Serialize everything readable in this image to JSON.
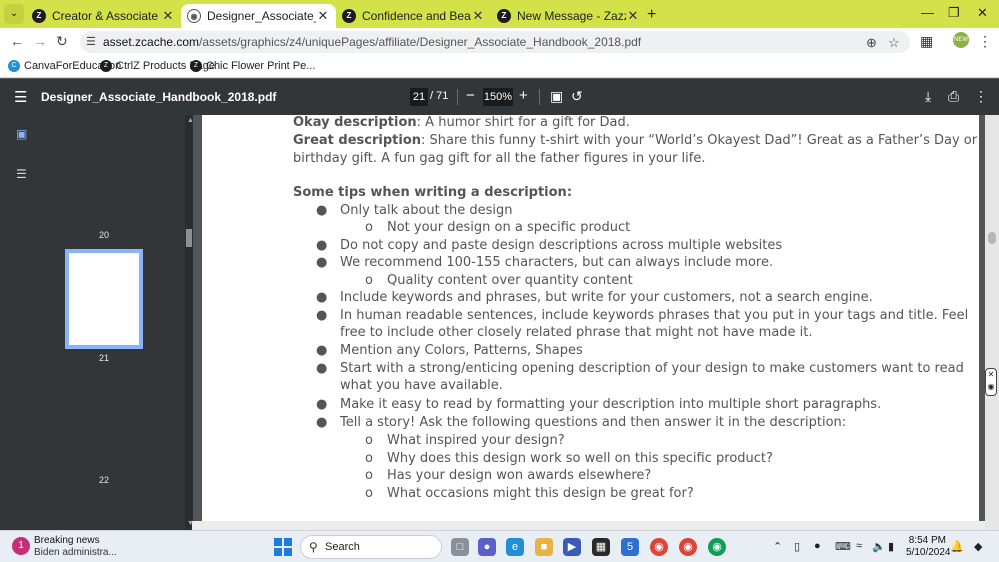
{
  "browser": {
    "tabs": [
      {
        "title": "Creator & Associate Handbook",
        "favicon": "z"
      },
      {
        "title": "Designer_Associate_Handbook",
        "favicon": "globe"
      },
      {
        "title": "Confidence and Beauty Positive",
        "favicon": "z"
      },
      {
        "title": "New Message - Zazzle",
        "favicon": "z"
      }
    ],
    "url_host": "asset.zcache.com",
    "url_path": "/assets/graphics/z4/uniquePages/affiliate/Designer_Associate_Handbook_2018.pdf",
    "bookmarks": [
      "CanvaForEducation",
      "CtrlZ Products Page",
      "Chic Flower Print Pe..."
    ],
    "profile_label": "NEW"
  },
  "pdf": {
    "filename": "Designer_Associate_Handbook_2018.pdf",
    "current_page": "21",
    "total_pages": "/ 71",
    "zoom": "150%",
    "thumb_labels": [
      "20",
      "21",
      "22"
    ]
  },
  "content": {
    "okay_label": "Okay description",
    "okay_text": ": A humor shirt for a gift for Dad.",
    "great_label": "Great description",
    "great_text_1": ": Share this funny t-shirt with your “World’s Okayest Dad”! Great as a Father’s Day or",
    "great_text_2": "birthday gift. A fun gag gift for all the father figures in your life.",
    "tips_heading": "Some tips when writing a description:",
    "items": [
      "Only talk about the design",
      "Not your design on a specific product",
      "Do not copy and paste design descriptions across multiple websites",
      "We recommend 100-155 characters, but can always include more.",
      "Quality content over quantity content",
      "Include keywords and phrases, but write for your customers, not a search engine.",
      "In human readable sentences, include keywords phrases that you put in your tags and title. Feel",
      "free to include other closely related phrase that might not have made it.",
      "Mention any Colors, Patterns, Shapes",
      "Start with a strong/enticing opening description of your design to make customers want to read",
      "what you have available.",
      "Make it easy to read by formatting your description into multiple short paragraphs.",
      "Tell a story! Ask the following questions and then answer it in the description:",
      "What inspired your design?",
      "Why does this design work so well on this specific product?",
      "Has your design won awards elsewhere?",
      "What occasions might this design be great for?"
    ]
  },
  "taskbar": {
    "news_title": "Breaking news",
    "news_sub": "Biden administra...",
    "news_badge": "1",
    "search_label": "Search",
    "time": "8:54 PM",
    "date": "5/10/2024"
  }
}
